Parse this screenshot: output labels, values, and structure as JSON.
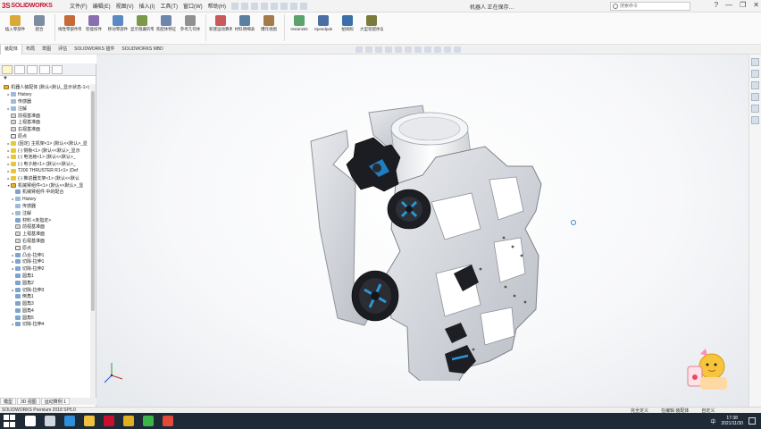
{
  "app": {
    "brand": "SOLIDWORKS",
    "brand_mark": "3S",
    "document_title": "机器人 正在保存…",
    "menu": [
      "文件(F)",
      "编辑(E)",
      "视图(V)",
      "插入(I)",
      "工具(T)",
      "窗口(W)",
      "帮助(H)"
    ],
    "search_placeholder": "搜索命令",
    "window_controls": [
      "?",
      "—",
      "❐",
      "✕"
    ]
  },
  "ribbon": {
    "buttons": [
      {
        "label": "插入零部件",
        "color": "#d9a93a"
      },
      {
        "label": "配合",
        "color": "#7c8da3"
      },
      {
        "label": "线性零部件阵列",
        "color": "#c76a3a"
      },
      {
        "label": "智能扣件",
        "color": "#8a6fb0"
      },
      {
        "label": "移动零部件",
        "color": "#5a8ac4"
      },
      {
        "label": "显示隐藏的零部件",
        "color": "#7a9a4a"
      },
      {
        "label": "装配体特征",
        "color": "#6c86ad"
      },
      {
        "label": "参考几何体",
        "color": "#909090"
      },
      {
        "label": "新建运动算例",
        "color": "#c85a5a"
      },
      {
        "label": "材料明细表",
        "color": "#5a7fa3"
      },
      {
        "label": "爆炸视图",
        "color": "#a37a4a"
      },
      {
        "label": "Instant3D",
        "color": "#5aa36a"
      },
      {
        "label": "Speedpak",
        "color": "#4a6fa3"
      },
      {
        "label": "拍快照",
        "color": "#3a6fa8"
      },
      {
        "label": "大型装配体设置",
        "color": "#7a7a3a"
      }
    ]
  },
  "command_tabs": [
    "装配体",
    "布局",
    "草图",
    "评估",
    "SOLIDWORKS 插件",
    "SOLIDWORKS MBD"
  ],
  "feature_tree": {
    "filter_icon": "funnel-icon",
    "nodes": [
      {
        "indent": 0,
        "icon": "asm",
        "label": "机器人装配体 (默认<默认_显示状态-1>)",
        "twist": ""
      },
      {
        "indent": 1,
        "icon": "folder",
        "label": "History",
        "twist": "▸"
      },
      {
        "indent": 1,
        "icon": "folder",
        "label": "传感器",
        "twist": ""
      },
      {
        "indent": 1,
        "icon": "folder",
        "label": "注解",
        "twist": "▸"
      },
      {
        "indent": 1,
        "icon": "plane",
        "label": "前视基准面",
        "twist": ""
      },
      {
        "indent": 1,
        "icon": "plane",
        "label": "上视基准面",
        "twist": ""
      },
      {
        "indent": 1,
        "icon": "plane",
        "label": "右视基准面",
        "twist": ""
      },
      {
        "indent": 1,
        "icon": "orig",
        "label": "原点",
        "twist": ""
      },
      {
        "indent": 1,
        "icon": "part",
        "label": "(固定) 主机架<1> (默认<<默认>_显",
        "twist": "▸"
      },
      {
        "indent": 1,
        "icon": "part",
        "label": "(-) 侧板<1> (默认<<默认>_显示",
        "twist": "▸"
      },
      {
        "indent": 1,
        "icon": "part",
        "label": "(-) 电池舱<1> (默认<<默认>_",
        "twist": "▸"
      },
      {
        "indent": 1,
        "icon": "part",
        "label": "(-) 电子舱<1> (默认<<默认>_",
        "twist": "▸"
      },
      {
        "indent": 1,
        "icon": "part",
        "label": "T200 THRUSTER R1<1> (Def",
        "twist": "▸"
      },
      {
        "indent": 1,
        "icon": "part",
        "label": "(-) 推进器支架<1> (默认<<默认",
        "twist": "▸"
      },
      {
        "indent": 1,
        "icon": "asm",
        "label": "机械臂组件<1> (默认<<默认>_显",
        "twist": "▾"
      },
      {
        "indent": 2,
        "icon": "feat",
        "label": "机械臂组件 中的配合",
        "twist": ""
      },
      {
        "indent": 2,
        "icon": "folder",
        "label": "History",
        "twist": "▸"
      },
      {
        "indent": 2,
        "icon": "folder",
        "label": "传感器",
        "twist": ""
      },
      {
        "indent": 2,
        "icon": "folder",
        "label": "注解",
        "twist": "▸"
      },
      {
        "indent": 2,
        "icon": "feat",
        "label": "材料 <未指定>",
        "twist": ""
      },
      {
        "indent": 2,
        "icon": "plane",
        "label": "前视基准面",
        "twist": ""
      },
      {
        "indent": 2,
        "icon": "plane",
        "label": "上视基准面",
        "twist": ""
      },
      {
        "indent": 2,
        "icon": "plane",
        "label": "右视基准面",
        "twist": ""
      },
      {
        "indent": 2,
        "icon": "orig",
        "label": "原点",
        "twist": ""
      },
      {
        "indent": 2,
        "icon": "feat",
        "label": "凸台-拉伸1",
        "twist": "▸"
      },
      {
        "indent": 2,
        "icon": "feat",
        "label": "切除-拉伸1",
        "twist": "▸"
      },
      {
        "indent": 2,
        "icon": "feat",
        "label": "切除-拉伸2",
        "twist": "▸"
      },
      {
        "indent": 2,
        "icon": "feat",
        "label": "圆角1",
        "twist": ""
      },
      {
        "indent": 2,
        "icon": "feat",
        "label": "圆角2",
        "twist": ""
      },
      {
        "indent": 2,
        "icon": "feat",
        "label": "切除-拉伸3",
        "twist": "▸"
      },
      {
        "indent": 2,
        "icon": "feat",
        "label": "倒角1",
        "twist": ""
      },
      {
        "indent": 2,
        "icon": "feat",
        "label": "圆角3",
        "twist": ""
      },
      {
        "indent": 2,
        "icon": "feat",
        "label": "圆角4",
        "twist": ""
      },
      {
        "indent": 2,
        "icon": "feat",
        "label": "圆角5",
        "twist": ""
      },
      {
        "indent": 2,
        "icon": "feat",
        "label": "切除-拉伸4",
        "twist": "▸"
      }
    ]
  },
  "bottom_tabs": [
    "模型",
    "3D 视图",
    "运动算例 1"
  ],
  "status": {
    "left": "SOLIDWORKS Premium 2018 SP5.0",
    "right": [
      "完全定义",
      "在编辑 装配体",
      "自定义"
    ]
  },
  "taskbar": {
    "icons": [
      {
        "name": "search-icon",
        "color": "#ffffff"
      },
      {
        "name": "task-view-icon",
        "color": "#cfd6df"
      },
      {
        "name": "edge-icon",
        "color": "#2f8fd8"
      },
      {
        "name": "file-explorer-icon",
        "color": "#f0c040"
      },
      {
        "name": "solidworks-taskbar-icon",
        "color": "#c8102e"
      },
      {
        "name": "chrome-icon",
        "color": "#e0b020"
      },
      {
        "name": "wechat-icon",
        "color": "#3bb54a"
      },
      {
        "name": "screen-recorder-icon",
        "color": "#e24a3a"
      }
    ],
    "lang": "中",
    "time": "17:38",
    "date": "2021/11/30"
  }
}
